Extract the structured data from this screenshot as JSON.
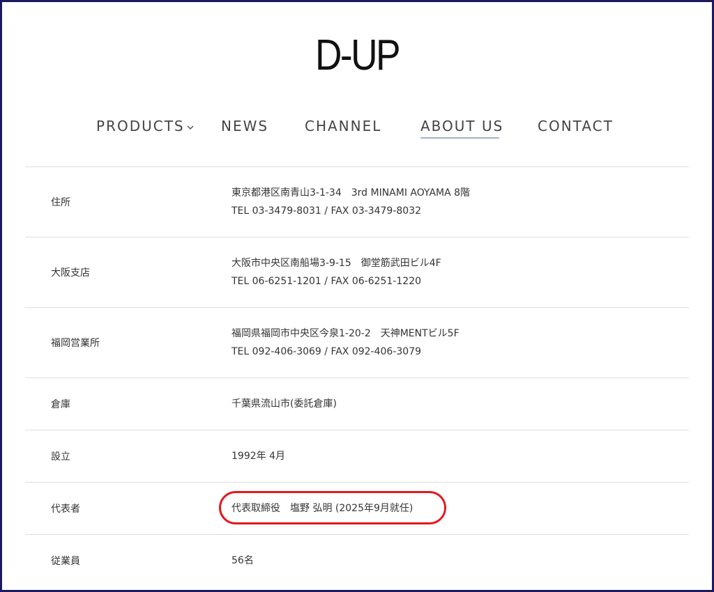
{
  "brand": {
    "logo_text": "D-UP"
  },
  "nav": {
    "items": [
      {
        "label": "PRODUCTS",
        "has_dropdown": true,
        "dropdown_icon": "chevron-down-icon"
      },
      {
        "label": "NEWS"
      },
      {
        "label": "CHANNEL"
      },
      {
        "label": "ABOUT US",
        "active": true
      },
      {
        "label": "CONTACT"
      }
    ],
    "active_underline_color": "#9fb3cc"
  },
  "company_info": {
    "rows": [
      {
        "label": "住所",
        "lines": [
          "東京都港区南青山3-1-34　3rd MINAMI AOYAMA 8階",
          "TEL 03-3479-8031 / FAX 03-3479-8032"
        ]
      },
      {
        "label": "大阪支店",
        "lines": [
          "大阪市中央区南船場3-9-15　御堂筋武田ビル4F",
          "TEL 06-6251-1201 / FAX 06-6251-1220"
        ]
      },
      {
        "label": "福岡営業所",
        "lines": [
          "福岡県福岡市中央区今泉1-20-2　天神MENTビル5F",
          "TEL 092-406-3069 / FAX 092-406-3079"
        ]
      },
      {
        "label": "倉庫",
        "lines": [
          "千葉県流山市(委託倉庫)"
        ]
      },
      {
        "label": "設立",
        "lines": [
          "1992年 4月"
        ]
      },
      {
        "label": "代表者",
        "lines": [
          "代表取締役　塩野 弘明 (2025年9月就任)"
        ],
        "highlighted": true
      },
      {
        "label": "従業員",
        "lines": [
          "56名"
        ]
      }
    ]
  },
  "colors": {
    "frame_border": "#1c1a5c",
    "highlight_ring": "#e3191f",
    "row_divider": "#dddddd",
    "text": "#333333"
  }
}
